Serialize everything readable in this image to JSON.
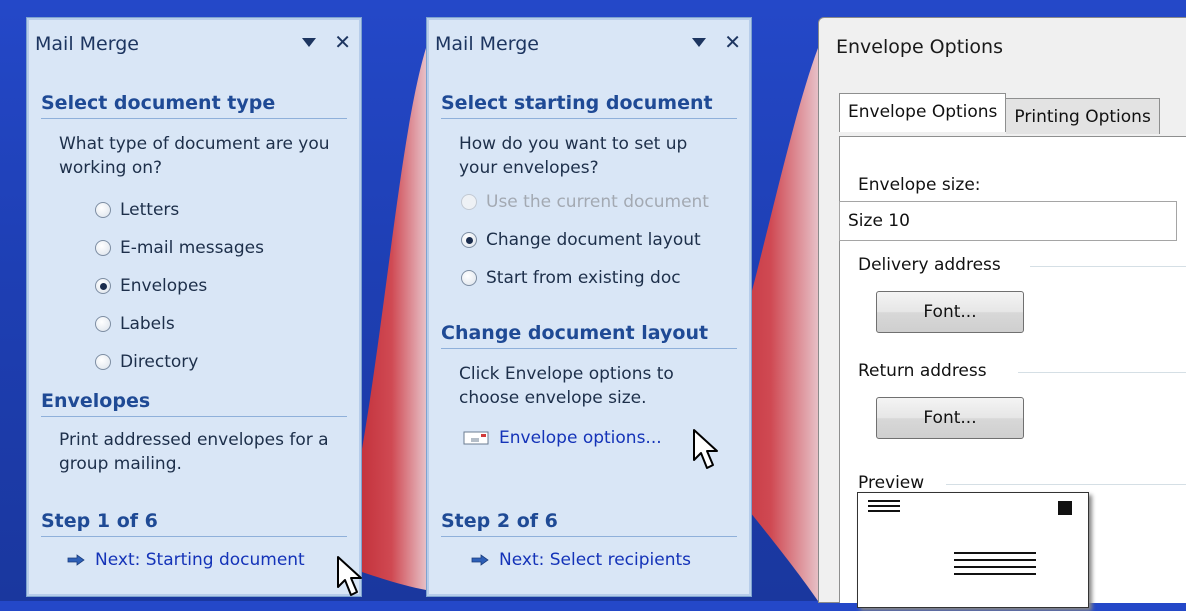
{
  "panel1": {
    "title": "Mail Merge",
    "section_heading": "Select document type",
    "question": "What type of document are you working on?",
    "options": [
      {
        "label": "Letters",
        "selected": false
      },
      {
        "label": "E-mail messages",
        "selected": false
      },
      {
        "label": "Envelopes",
        "selected": true
      },
      {
        "label": "Labels",
        "selected": false
      },
      {
        "label": "Directory",
        "selected": false
      }
    ],
    "info_heading": "Envelopes",
    "info_text": "Print addressed envelopes for a group mailing.",
    "step": "Step 1 of 6",
    "next_link": "Next: Starting document"
  },
  "panel2": {
    "title": "Mail Merge",
    "section_heading": "Select starting document",
    "question": "How do you want to set up your envelopes?",
    "options": [
      {
        "label": "Use the current document",
        "selected": false,
        "disabled": true
      },
      {
        "label": "Change document layout",
        "selected": true,
        "disabled": false
      },
      {
        "label": "Start from existing doc",
        "selected": false,
        "disabled": false
      }
    ],
    "layout_heading": "Change document layout",
    "layout_text": "Click Envelope options to choose envelope size.",
    "envelope_link": "Envelope options...",
    "step": "Step 2 of 6",
    "next_link": "Next: Select recipients"
  },
  "dialog": {
    "title": "Envelope Options",
    "tabs": [
      "Envelope Options",
      "Printing Options"
    ],
    "envelope_size_label": "Envelope size:",
    "envelope_size_value": "Size 10",
    "delivery_label": "Delivery address",
    "delivery_font_button": "Font...",
    "return_label": "Return address",
    "return_font_button": "Font...",
    "preview_label": "Preview"
  },
  "colors": {
    "background": "#2448c8",
    "panel": "#d9e6f6",
    "heading": "#1f4a95",
    "link": "#1433b8",
    "callout": "#c4262b"
  }
}
